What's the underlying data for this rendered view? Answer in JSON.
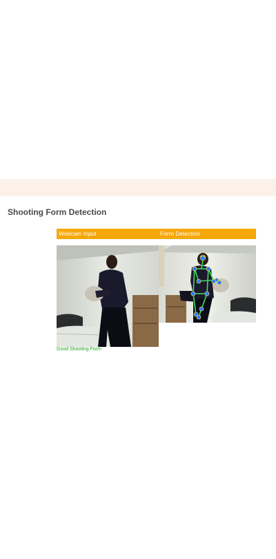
{
  "page": {
    "title": "Shooting Form Detection"
  },
  "panels": {
    "webcam_label": "Webcam Input",
    "detection_label": "Form Detection"
  },
  "status": {
    "text": "Good Shooting Form",
    "color": "#1a9e1a"
  },
  "colors": {
    "banner": "#fcf1e9",
    "header_bar": "#f6a70a",
    "skeleton_joint": "#2a7cff",
    "skeleton_bone": "#3de05a"
  }
}
